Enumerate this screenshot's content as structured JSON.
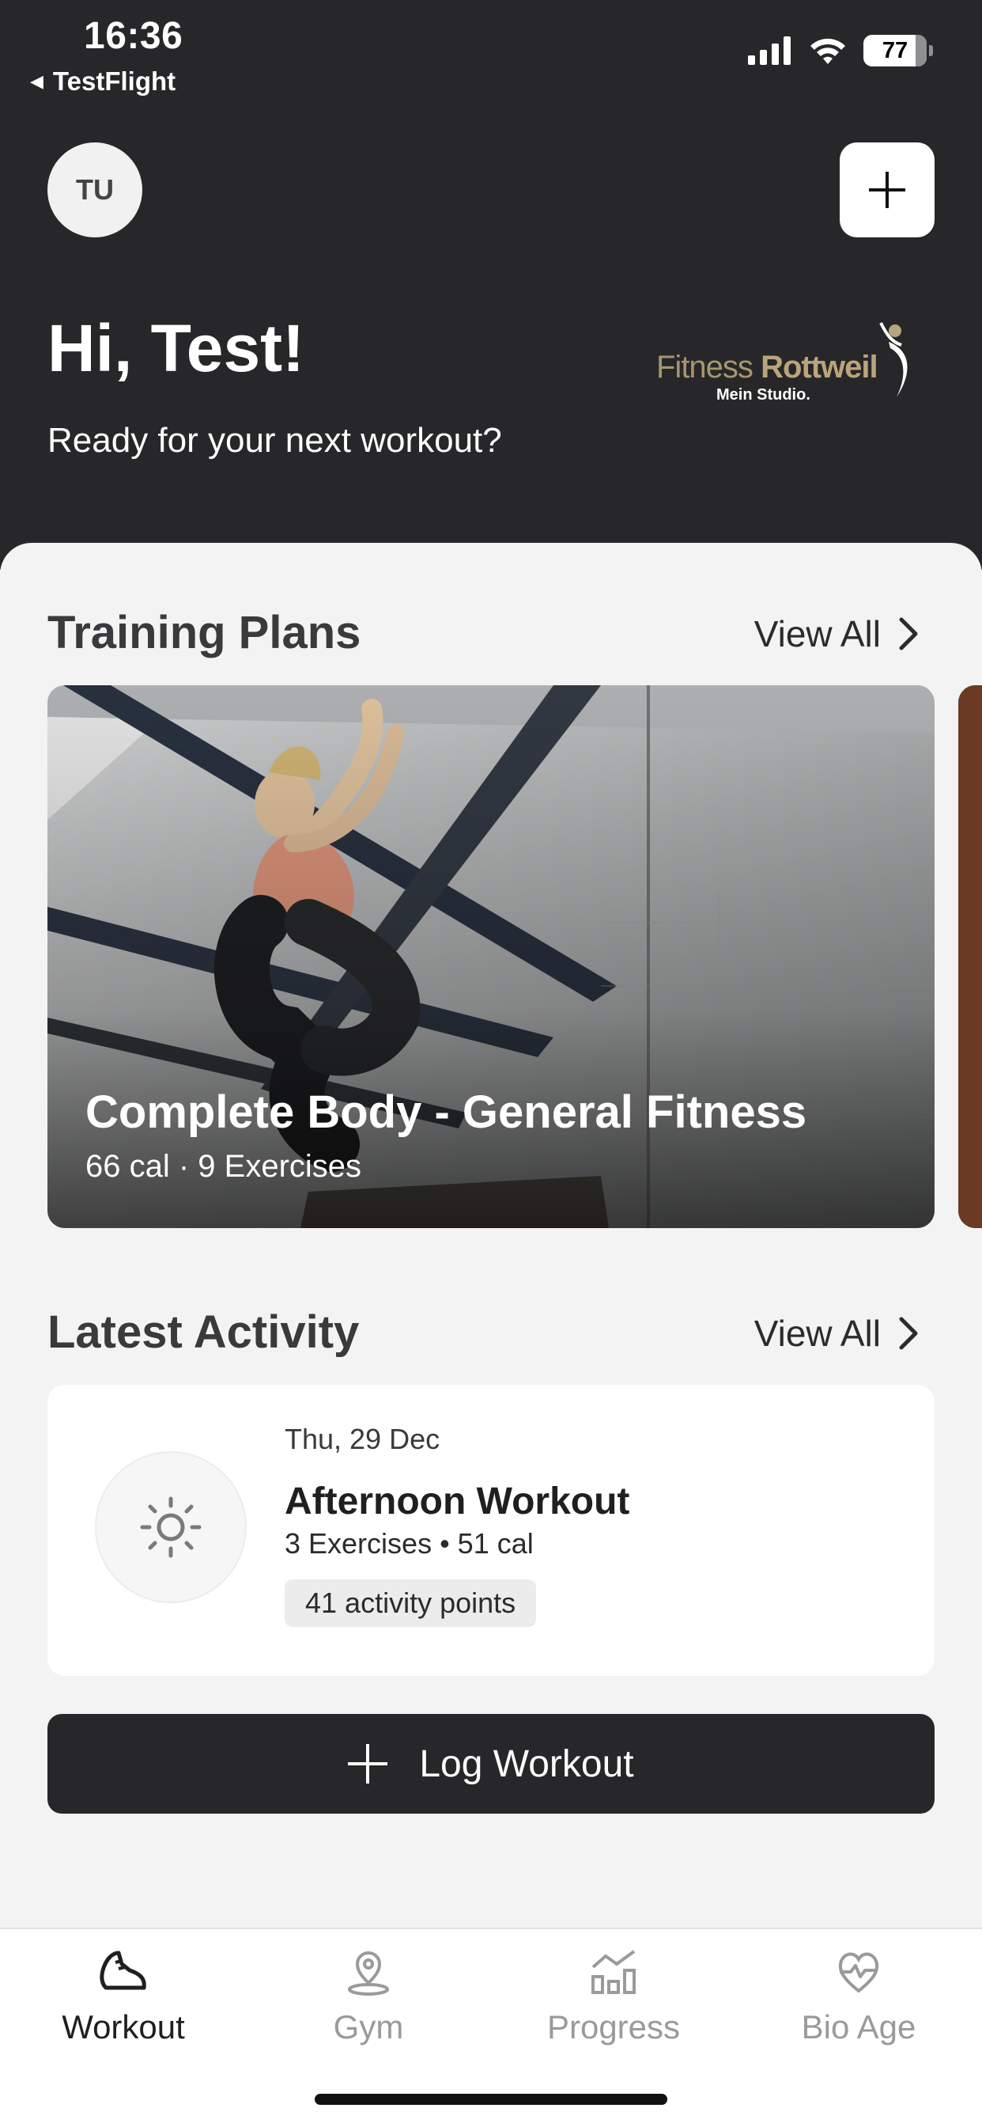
{
  "status_bar": {
    "time": "16:36",
    "back_app": "TestFlight",
    "battery": "77"
  },
  "header": {
    "avatar_initials": "TU",
    "greeting": "Hi, Test!",
    "subtitle": "Ready for your next workout?",
    "logo": {
      "word1": "Fitness",
      "word2": "Rottweil",
      "tagline": "Mein Studio."
    }
  },
  "training_plans": {
    "title": "Training Plans",
    "view_all": "View All",
    "card": {
      "title": "Complete Body - General Fitness",
      "meta": "66 cal · 9 Exercises"
    }
  },
  "latest_activity": {
    "title": "Latest Activity",
    "view_all": "View All",
    "item": {
      "date": "Thu, 29 Dec",
      "title": "Afternoon Workout",
      "meta": "3 Exercises • 51 cal",
      "badge": "41 activity points"
    }
  },
  "log_workout": {
    "label": "Log Workout"
  },
  "tabs": [
    {
      "label": "Workout",
      "icon": "shoe-icon",
      "active": true
    },
    {
      "label": "Gym",
      "icon": "location-pin-icon",
      "active": false
    },
    {
      "label": "Progress",
      "icon": "chart-icon",
      "active": false
    },
    {
      "label": "Bio Age",
      "icon": "heart-pulse-icon",
      "active": false
    }
  ],
  "colors": {
    "header_bg": "#272729",
    "accent_gold": "#b9a57d",
    "sheet_bg": "#f3f3f4"
  }
}
